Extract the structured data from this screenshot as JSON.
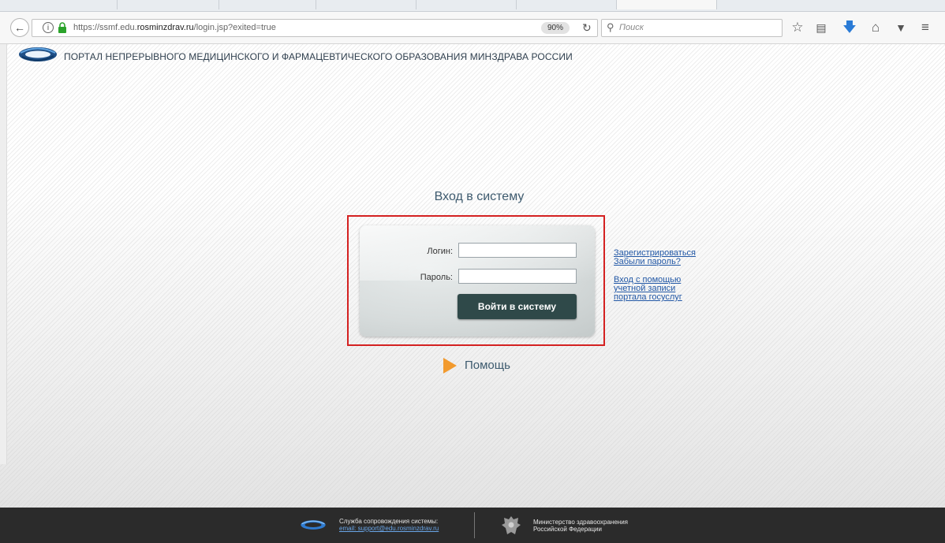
{
  "browser": {
    "url_prefix": "https://ssmf.edu.",
    "url_domain": "rosminzdrav.ru",
    "url_suffix": "/login.jsp?exited=true",
    "zoom": "90%",
    "search_placeholder": "Поиск"
  },
  "header": {
    "title": "ПОРТАЛ НЕПРЕРЫВНОГО МЕДИЦИНСКОГО И ФАРМАЦЕВТИЧЕСКОГО ОБРАЗОВАНИЯ МИНЗДРАВА РОССИИ"
  },
  "login": {
    "heading": "Вход в систему",
    "login_label": "Логин:",
    "password_label": "Пароль:",
    "login_value": "",
    "password_value": "",
    "submit_label": "Войти в систему"
  },
  "links": {
    "register": "Зарегистрироваться",
    "forgot": "Забыли пароль?",
    "gosuslugi_line1": "Вход с помощью",
    "gosuslugi_line2": "учетной записи",
    "gosuslugi_line3": "портала госуслуг"
  },
  "help": {
    "label": "Помощь"
  },
  "footer": {
    "support_title": "Служба сопровождения системы:",
    "support_email": "email: support@edu.rosminzdrav.ru",
    "ministry_line1": "Министерство здравоохранения",
    "ministry_line2": "Российской Федерации"
  },
  "colors": {
    "highlight": "#d42121",
    "button": "#2f4949",
    "link": "#2258a6",
    "help_arrow": "#f29a2e",
    "footer_bg": "#2b2b2b"
  }
}
